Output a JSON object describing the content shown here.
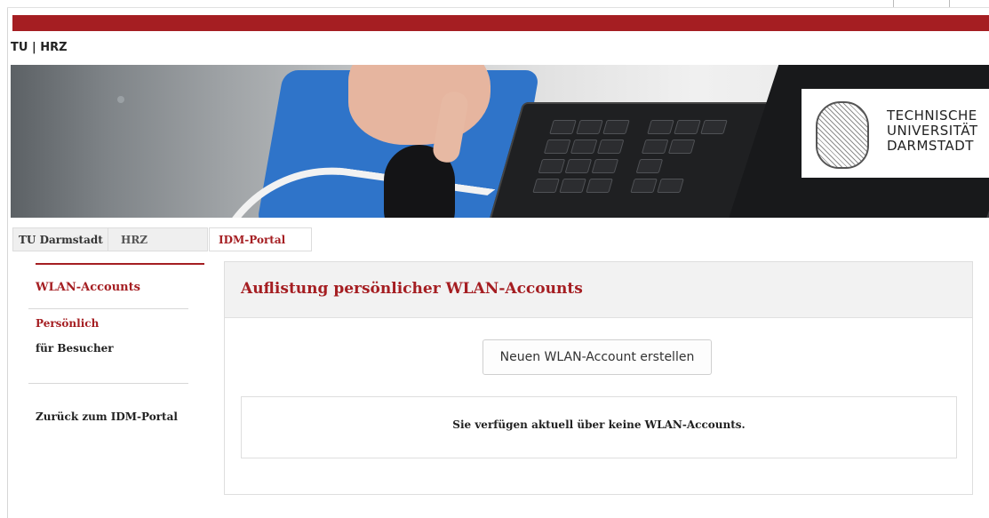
{
  "header": {
    "brand": "TU | HRZ"
  },
  "banner": {
    "logo_text": "TECHNISCHE\nUNIVERSITÄT\nDARMSTADT"
  },
  "tabs": [
    {
      "label": "TU Darmstadt"
    },
    {
      "label": "HRZ"
    },
    {
      "label": "IDM-Portal"
    }
  ],
  "sidebar": {
    "title": "WLAN-Accounts",
    "items": [
      {
        "label": "Persönlich"
      },
      {
        "label": "für Besucher"
      }
    ],
    "back_label": "Zurück zum IDM-Portal"
  },
  "main": {
    "title": "Auflistung persönlicher WLAN-Accounts",
    "new_button": "Neuen WLAN-Account erstellen",
    "empty_message": "Sie verfügen aktuell über keine WLAN-Accounts."
  },
  "colors": {
    "accent": "#a51e22",
    "panel_head": "#f2f2f2",
    "tab_bg": "#efefef"
  },
  "icons": [
    "university-seal-icon"
  ]
}
